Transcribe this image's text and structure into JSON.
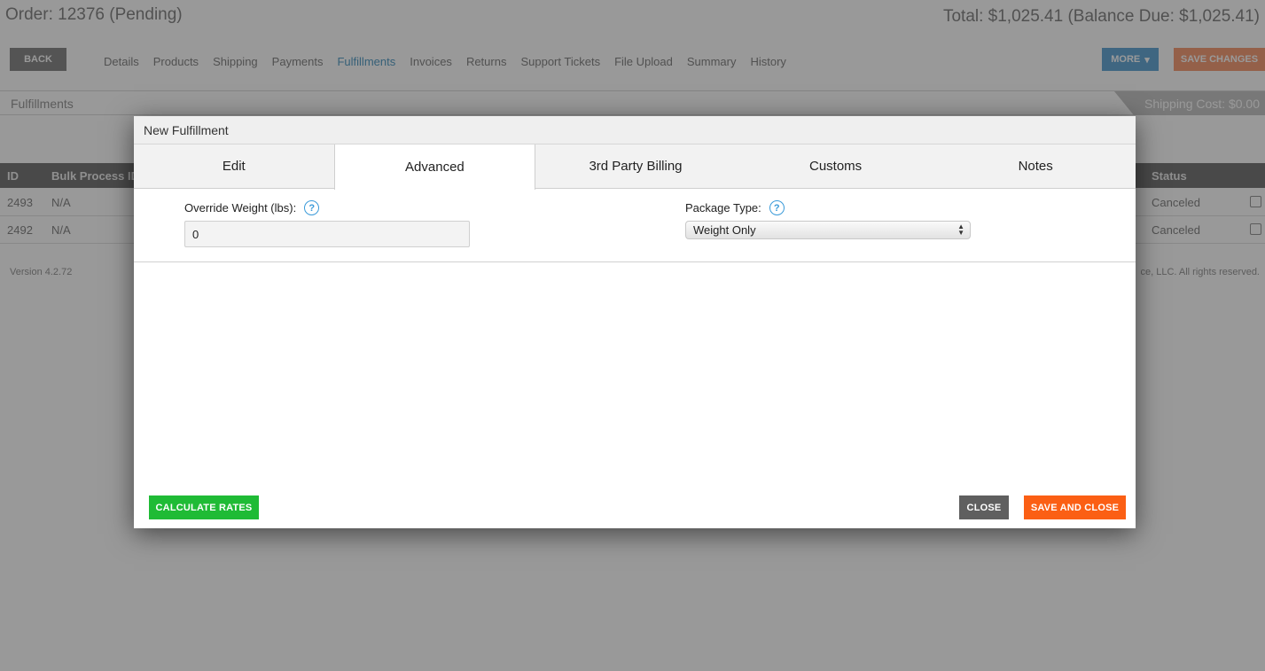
{
  "background_page": {
    "order_title": "Order: 12376 (Pending)",
    "order_total": "Total: $1,025.41 (Balance Due: $1,025.41)",
    "back_label": "BACK",
    "nav_items": [
      "Details",
      "Products",
      "Shipping",
      "Payments",
      "Fulfillments",
      "Invoices",
      "Returns",
      "Support Tickets",
      "File Upload",
      "Summary",
      "History"
    ],
    "active_nav": "Fulfillments",
    "more_label": "MORE",
    "save_changes_label": "SAVE CHANGES",
    "section_title": "Fulfillments",
    "shipping_cost": "Shipping Cost: $0.00",
    "table_headers": {
      "id": "ID",
      "bulk": "Bulk Process ID",
      "status": "Status"
    },
    "rows": [
      {
        "id": "2493",
        "bulk": "N/A",
        "status": "Canceled"
      },
      {
        "id": "2492",
        "bulk": "N/A",
        "status": "Canceled"
      }
    ],
    "version": "Version 4.2.72",
    "copyright": "ce, LLC. All rights reserved."
  },
  "modal": {
    "title": "New Fulfillment",
    "tabs": [
      {
        "label": "Edit"
      },
      {
        "label": "Advanced"
      },
      {
        "label": "3rd Party Billing"
      },
      {
        "label": "Customs"
      },
      {
        "label": "Notes"
      }
    ],
    "active_tab": "Advanced",
    "override_weight": {
      "label": "Override Weight (lbs):",
      "value": "0"
    },
    "package_type": {
      "label": "Package Type:",
      "selected": "Weight Only"
    },
    "help_glyph": "?",
    "buttons": {
      "calculate": "CALCULATE RATES",
      "close": "CLOSE",
      "save_close": "SAVE AND CLOSE"
    }
  },
  "colors": {
    "calculate": "#1fbb35",
    "close": "#5f5f5f",
    "save_close": "#fb5f14",
    "help": "#3a9ad9",
    "active_nav": "#5aa0c8"
  }
}
